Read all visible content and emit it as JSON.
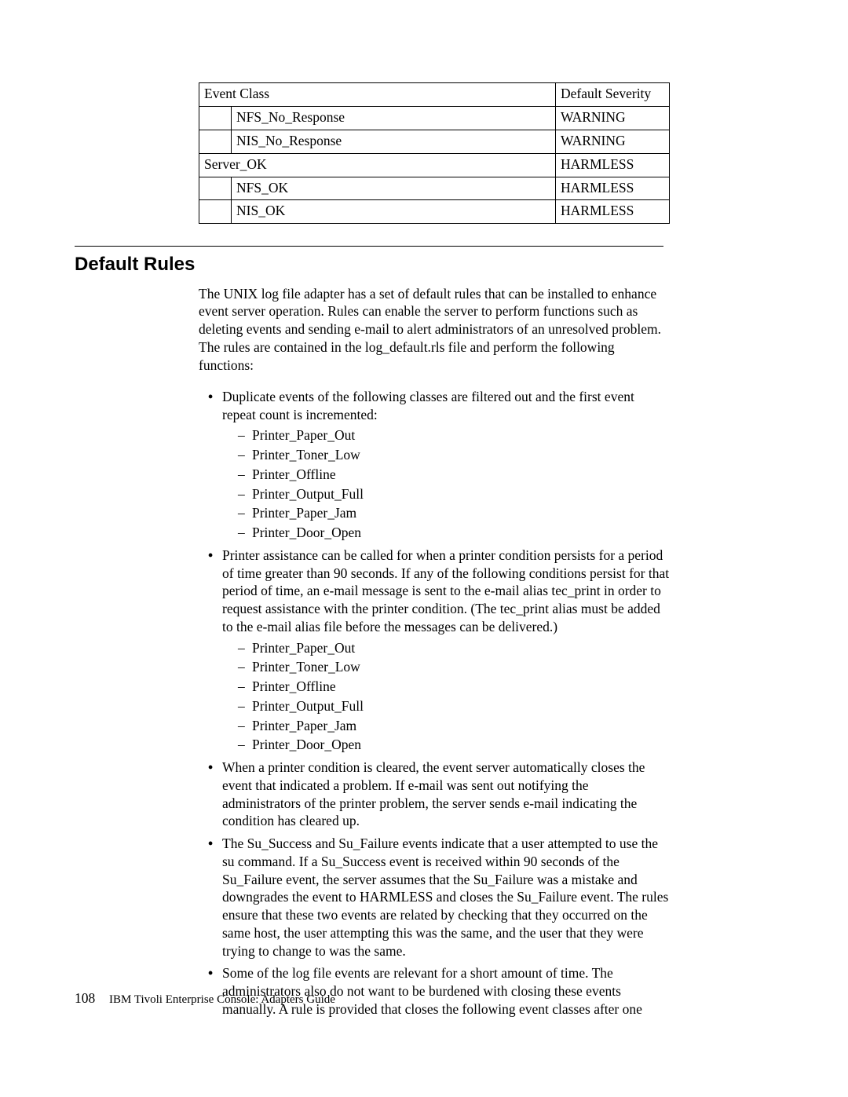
{
  "table": {
    "header": {
      "event_class": "Event Class",
      "default_severity": "Default Severity"
    },
    "rows": [
      {
        "indent": 1,
        "name": "NFS_No_Response",
        "severity": "WARNING"
      },
      {
        "indent": 1,
        "name": "NIS_No_Response",
        "severity": "WARNING"
      },
      {
        "indent": 0,
        "name": "Server_OK",
        "severity": "HARMLESS"
      },
      {
        "indent": 1,
        "name": "NFS_OK",
        "severity": "HARMLESS"
      },
      {
        "indent": 1,
        "name": "NIS_OK",
        "severity": "HARMLESS"
      }
    ]
  },
  "section_title": "Default Rules",
  "intro_para": "The UNIX log file adapter has a set of default rules that can be installed to enhance event server operation. Rules can enable the server to perform functions such as deleting events and sending e-mail to alert administrators of an unresolved problem. The rules are contained in the log_default.rls  file and perform the following functions:",
  "li1_text": "Duplicate events of the following classes are filtered out and the first event repeat count is incremented:",
  "li1_sub": [
    "Printer_Paper_Out",
    "Printer_Toner_Low",
    "Printer_Offline",
    "Printer_Output_Full",
    "Printer_Paper_Jam",
    "Printer_Door_Open"
  ],
  "li2_text": "Printer assistance can be called for when a printer condition persists for a period of time greater than 90 seconds. If any of the following conditions persist for that period of time, an e-mail message is sent to the e-mail alias tec_print  in order to request assistance with the printer condition. (The tec_print  alias must be added to the e-mail alias file before the messages can be delivered.)",
  "li2_sub": [
    "Printer_Paper_Out",
    "Printer_Toner_Low",
    "Printer_Offline",
    "Printer_Output_Full",
    "Printer_Paper_Jam",
    "Printer_Door_Open"
  ],
  "li3_text": "When a printer condition is cleared, the event server automatically closes the event that indicated a problem. If e-mail was sent out notifying the administrators of the printer problem, the server sends e-mail indicating the condition has cleared up.",
  "li4_text": "The Su_Success  and Su_Failure  events indicate that a user attempted to use the su command. If a Su_Success  event is received within 90 seconds of the Su_Failure  event, the server assumes that the Su_Failure  was a mistake and downgrades the event to HARMLESS  and closes the Su_Failure  event. The rules ensure that these two events are related by checking that they occurred on the same host, the user attempting this was the same, and the user that they were trying to change to was the same.",
  "li5_text": "Some of the log file events are relevant for a short amount of time. The administrators also do not want to be burdened with closing these events manually. A rule is provided that closes the following event classes after one",
  "footer": {
    "page_num": "108",
    "book_title": "IBM Tivoli Enterprise Console: Adapters Guide"
  }
}
